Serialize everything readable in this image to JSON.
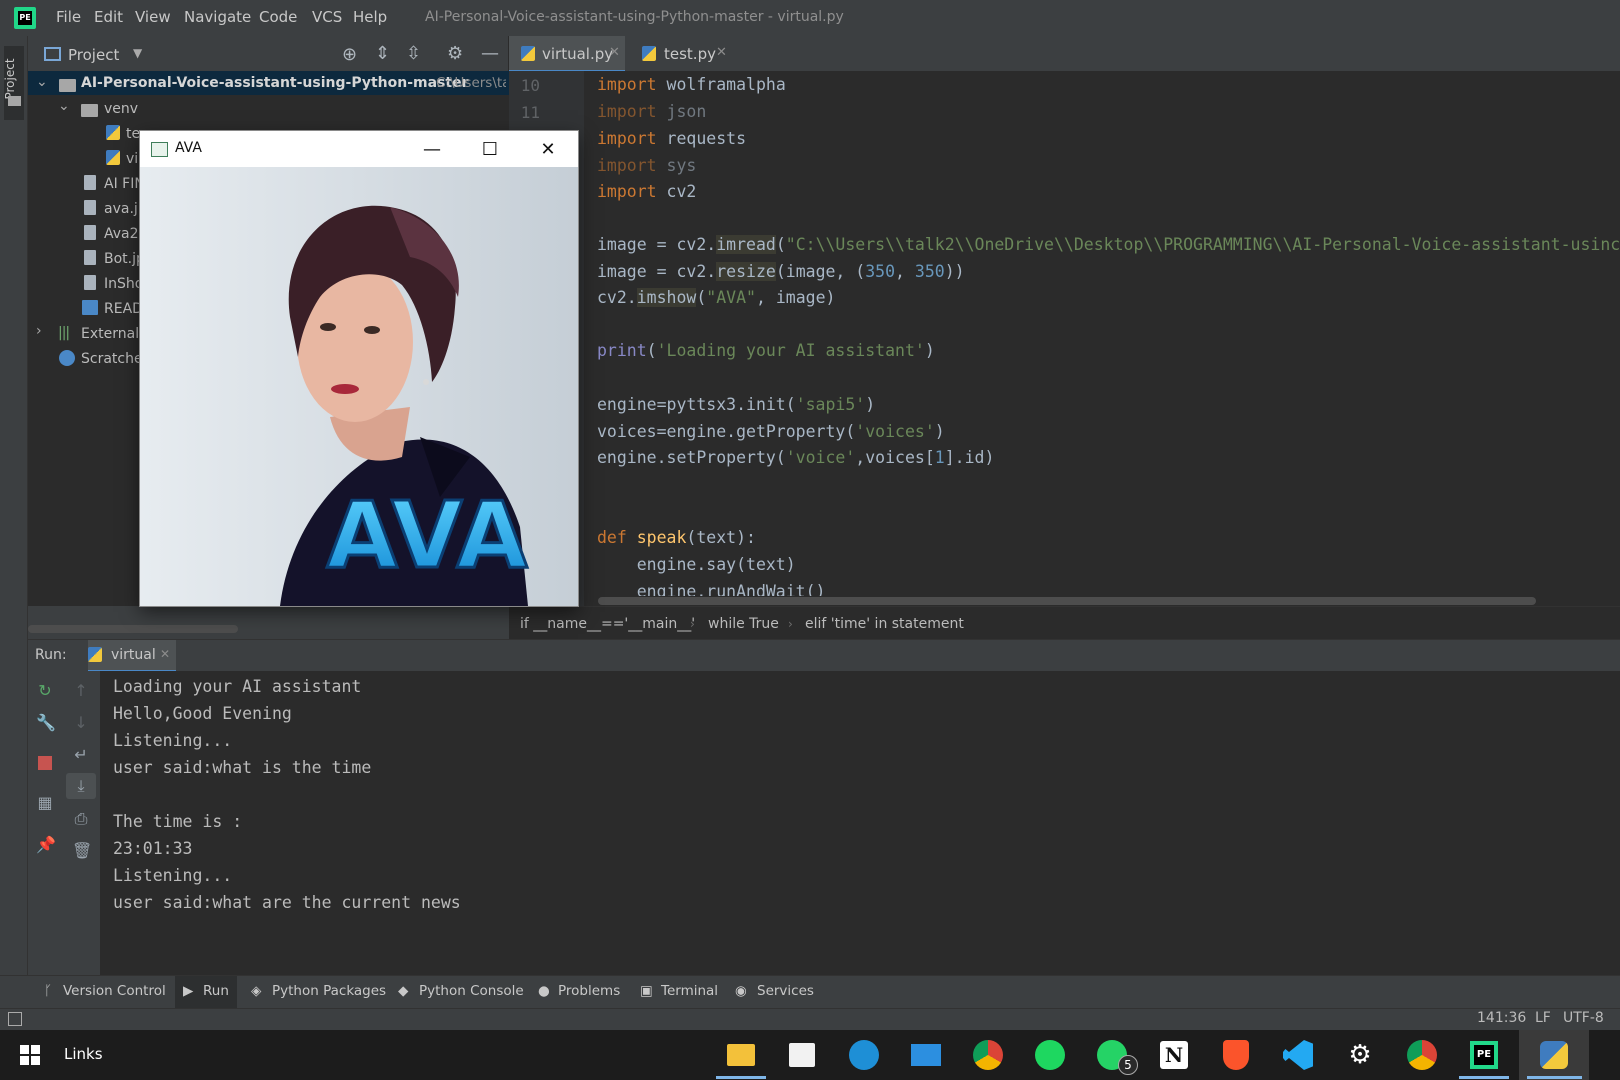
{
  "app": {
    "logo_text": "PE",
    "menu": [
      "File",
      "Edit",
      "View",
      "Navigate",
      "Code",
      "VCS",
      "Help"
    ],
    "window_title": "AI-Personal-Voice-assistant-using-Python-master - virtual.py"
  },
  "left_stripe": {
    "project_label": "Project"
  },
  "project_panel": {
    "title": "Project",
    "root_name": "AI-Personal-Voice-assistant-using-Python-master",
    "root_path": "C:\\Users\\ta",
    "items": [
      {
        "label": "venv",
        "icon": "folder-icon"
      },
      {
        "label": "te",
        "icon": "python-file-icon"
      },
      {
        "label": "vi",
        "icon": "python-file-icon"
      },
      {
        "label": "AI FIN",
        "icon": "file-icon"
      },
      {
        "label": "ava.jp",
        "icon": "image-file-icon"
      },
      {
        "label": "Ava2.",
        "icon": "image-file-icon"
      },
      {
        "label": "Bot.jp",
        "icon": "image-file-icon"
      },
      {
        "label": "InSho",
        "icon": "image-file-icon"
      },
      {
        "label": "READ",
        "icon": "markdown-file-icon"
      },
      {
        "label": "External",
        "icon": "library-icon"
      },
      {
        "label": "Scratches",
        "icon": "scratches-icon"
      }
    ]
  },
  "editor": {
    "tabs": [
      {
        "label": "virtual.py",
        "active": true
      },
      {
        "label": "test.py",
        "active": false
      }
    ],
    "line_numbers": [
      "10",
      "11"
    ],
    "breadcrumb": [
      "if __name__=='__main__'",
      "while True",
      "elif 'time' in statement"
    ]
  },
  "ava_window": {
    "title": "AVA",
    "image_text": "AVA"
  },
  "run_panel": {
    "label": "Run:",
    "tab": "virtual",
    "output": [
      "Loading your AI assistant",
      "Hello,Good Evening",
      "Listening...",
      "user said:what is the time",
      "",
      "The time is :",
      "23:01:33",
      "Listening...",
      "user said:what are the current news"
    ]
  },
  "bottom_tabs": [
    "Version Control",
    "Run",
    "Python Packages",
    "Python Console",
    "Problems",
    "Terminal",
    "Services"
  ],
  "status": {
    "position": "141:36",
    "line_sep": "LF",
    "encoding": "UTF-8"
  },
  "taskbar": {
    "search_label": "Links",
    "whatsapp_badge": "5",
    "pycharm_label": "PE",
    "notion_label": "N"
  }
}
